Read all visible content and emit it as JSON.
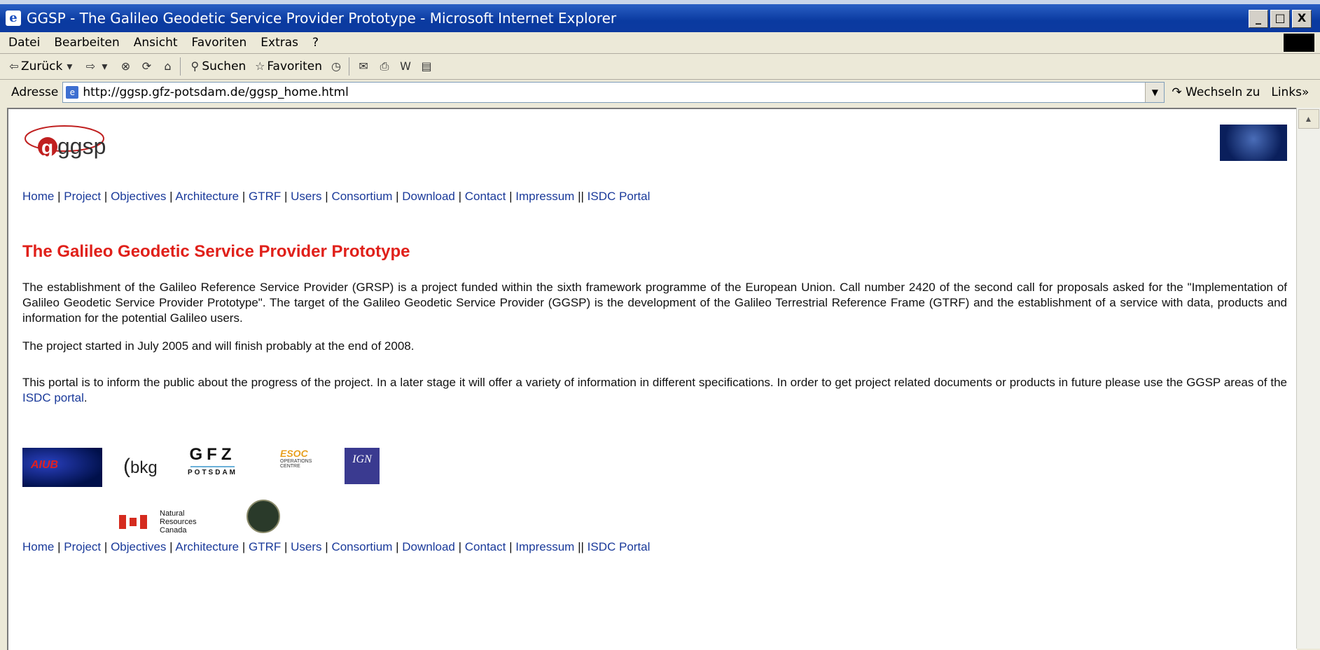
{
  "window": {
    "title": "GGSP - The Galileo Geodetic Service Provider Prototype - Microsoft Internet Explorer",
    "buttons": [
      "_",
      "□",
      "X"
    ]
  },
  "menu": [
    "Datei",
    "Bearbeiten",
    "Ansicht",
    "Favoriten",
    "Extras",
    "?"
  ],
  "toolbar": {
    "back": "Zurück",
    "search": "Suchen",
    "favorites": "Favoriten"
  },
  "address": {
    "label": "Adresse",
    "url": "http://ggsp.gfz-potsdam.de/ggsp_home.html",
    "go": "Wechseln zu",
    "links": "Links"
  },
  "page": {
    "logo_text": "ggsp",
    "nav": [
      "Home",
      "Project",
      "Objectives",
      "Architecture",
      "GTRF",
      "Users",
      "Consortium",
      "Download",
      "Contact",
      "Impressum",
      "ISDC Portal"
    ],
    "heading": "The Galileo Geodetic Service Provider Prototype",
    "p1": "The establishment of the Galileo Reference Service Provider (GRSP) is a project funded within the sixth framework programme of the European Union. Call number 2420 of the second call for proposals asked for the \"Implementation of Galileo Geodetic Service Provider Prototype\". The target of the Galileo Geodetic Service Provider (GGSP) is the development of the Galileo Terrestrial Reference Frame (GTRF) and the establishment of a service with data, products and information for the potential Galileo users.",
    "p2": "The project started in July 2005 and will finish probably at the end of 2008.",
    "p3_pre": "This portal is to inform the public about the progress of the project. In a later stage it will offer a variety of information in different specifications. In order to get project related documents or products in future please use the GGSP areas of the ",
    "p3_link": "ISDC portal",
    "p3_post": ".",
    "partner_logos": {
      "aiub": "AIUB",
      "bkg": "bkg",
      "gfz": "GFZ",
      "gfz_sub": "POTSDAM",
      "esoc": "ESOC",
      "esoc_sub": "OPERATIONS CENTRE",
      "ign": "IGN",
      "nrcan": "Natural Resources Canada"
    }
  }
}
